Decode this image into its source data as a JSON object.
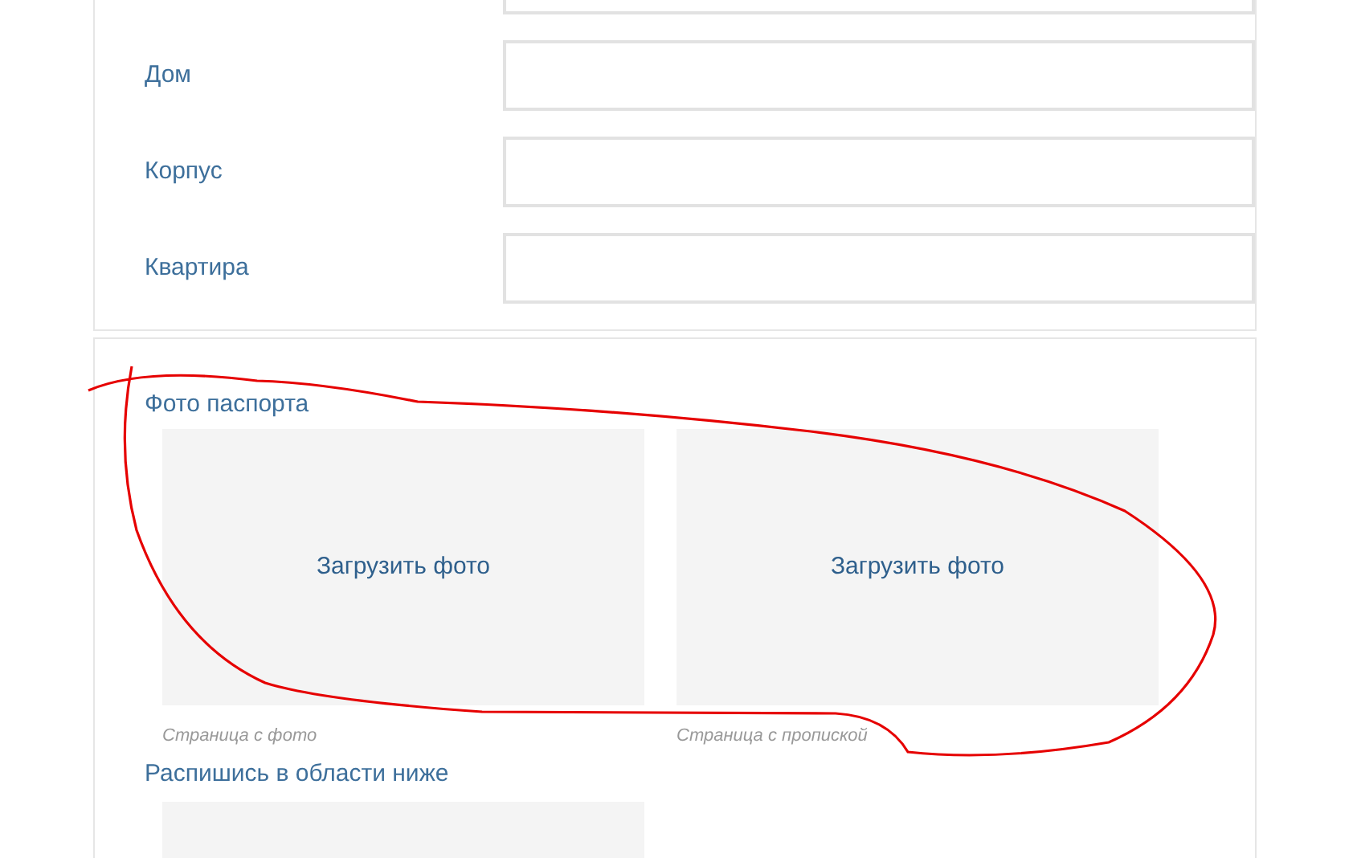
{
  "address_fields": [
    {
      "kind": "cut"
    },
    {
      "kind": "labeled",
      "label": "Дом"
    },
    {
      "kind": "labeled",
      "label": "Корпус"
    },
    {
      "kind": "labeled",
      "label": "Квартира"
    }
  ],
  "passport": {
    "title": "Фото паспорта",
    "uploads": [
      {
        "button": "Загрузить фото",
        "caption": "Страница с фото"
      },
      {
        "button": "Загрузить фото",
        "caption": "Страница с пропиской"
      }
    ]
  },
  "signature": {
    "title": "Распишись в области ниже"
  }
}
